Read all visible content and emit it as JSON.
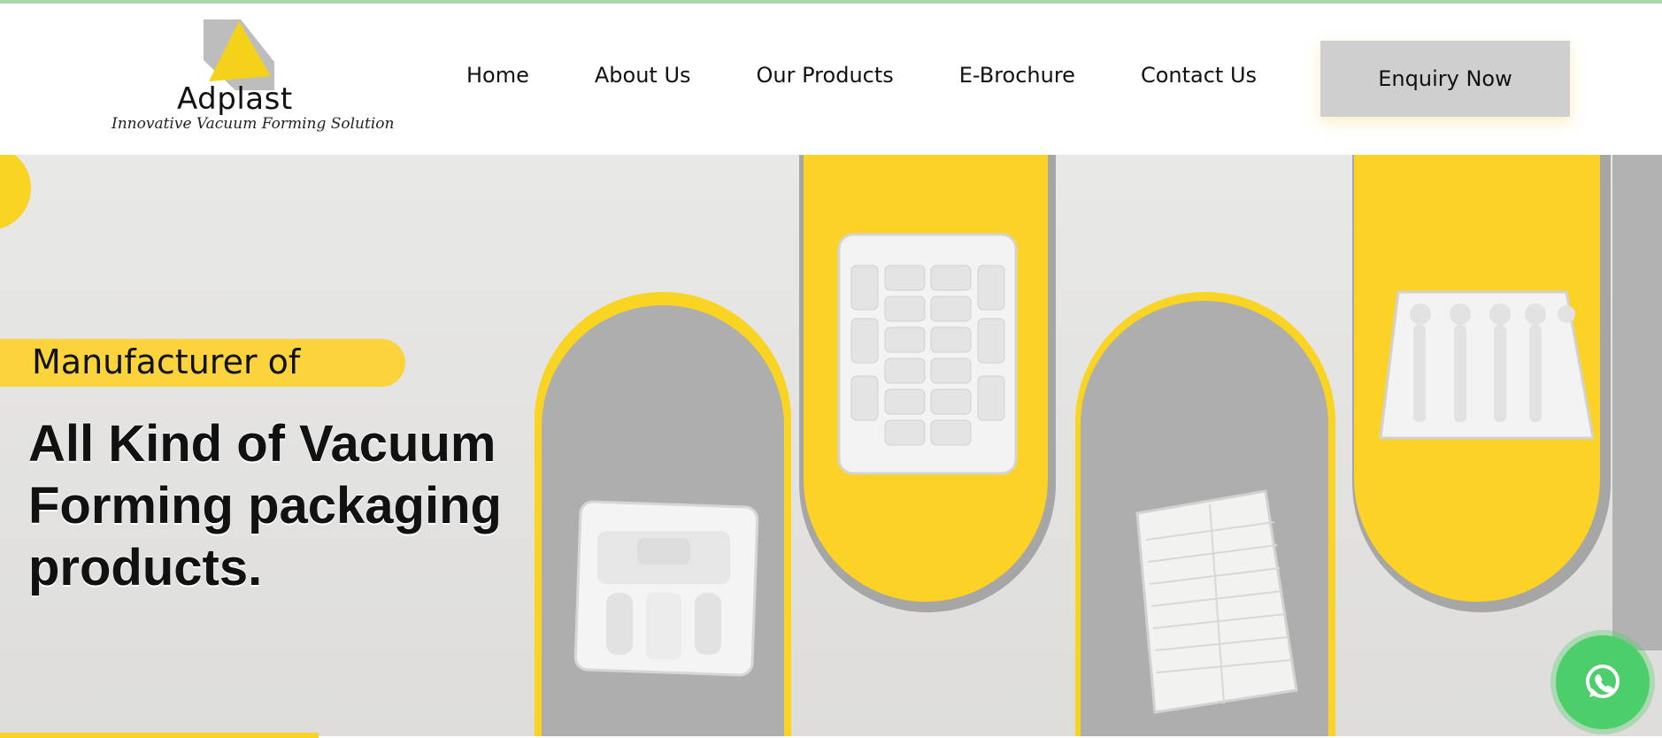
{
  "brand": {
    "name": "Adplast",
    "tagline": "Innovative Vacuum Forming Solution",
    "colors": {
      "yellow": "#F9D423",
      "gray": "#A6A6A6",
      "whatsapp": "#4CCF6B"
    }
  },
  "nav": {
    "items": [
      {
        "label": "Home"
      },
      {
        "label": "About Us"
      },
      {
        "label": "Our Products"
      },
      {
        "label": "E-Brochure"
      },
      {
        "label": "Contact Us"
      }
    ],
    "cta_label": "Enquiry Now"
  },
  "hero": {
    "eyebrow": "Manufacturer of",
    "headline": "All Kind of Vacuum Forming packaging products."
  },
  "icons": {
    "whatsapp": "whatsapp-icon",
    "logo": "logo-triangle-icon"
  }
}
